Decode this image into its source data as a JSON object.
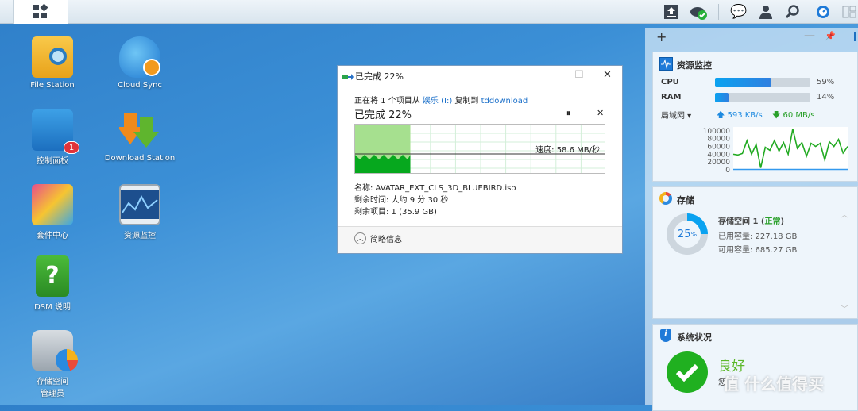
{
  "taskbar": {
    "icons": [
      "main-menu-icon",
      "upload-queue-icon",
      "cloud-sync-status-icon",
      "messages-icon",
      "user-icon",
      "search-icon",
      "widgets-icon",
      "panel-toggle-icon"
    ]
  },
  "desktop": {
    "icons": [
      {
        "label": "File Station",
        "icon": "file-station-icon"
      },
      {
        "label": "Cloud Sync",
        "icon": "cloud-sync-icon"
      },
      {
        "label": "控制面板",
        "icon": "control-panel-icon",
        "badge": "1"
      },
      {
        "label": "Download Station",
        "icon": "download-station-icon"
      },
      {
        "label": "套件中心",
        "icon": "package-center-icon"
      },
      {
        "label": "资源监控",
        "icon": "resource-monitor-icon"
      },
      {
        "label": "DSM 说明",
        "icon": "dsm-help-icon"
      },
      {
        "label": "存储空间\n管理员",
        "icon": "storage-manager-icon"
      }
    ]
  },
  "dialog": {
    "title": "已完成 22%",
    "copy_prefix": "正在将 1 个项目从",
    "source": "娱乐 (I:)",
    "copy_mid": "复制到",
    "destination": "tddownload",
    "progress_text": "已完成 22%",
    "progress": 22,
    "speed": "速度: 58.6 MB/秒",
    "name": "名称: AVATAR_EXT_CLS_3D_BLUEBIRD.iso",
    "time_left": "剩余时间: 大约 9 分 30 秒",
    "items_left": "剩余项目: 1 (35.9 GB)",
    "less_details": "简略信息",
    "colors": {
      "filled": "#06a81e",
      "light": "#a6e08f"
    }
  },
  "panel": {
    "resource": {
      "title": "资源监控",
      "cpu_label": "CPU",
      "cpu": 59,
      "cpu_text": "59%",
      "ram_label": "RAM",
      "ram": 14,
      "ram_text": "14%",
      "network": "局域网",
      "upload": "593 KB/s",
      "download": "60 MB/s",
      "chart_data": {
        "type": "line",
        "ylim": [
          0,
          110000
        ],
        "yticks": [
          "100000",
          "80000",
          "60000",
          "40000",
          "20000",
          "0"
        ],
        "series": [
          {
            "color": "#22aa22",
            "values": [
              40000,
              38000,
              42000,
              75000,
              40000,
              65000,
              5000,
              58000,
              50000,
              75000,
              48000,
              70000,
              40000,
              105000,
              55000,
              70000,
              35000,
              68000,
              60000,
              68000,
              25000,
              72000,
              60000,
              78000,
              43000,
              60000
            ]
          },
          {
            "color": "#3399ee",
            "values": [
              1000,
              1000,
              1000,
              1000,
              1000,
              1000,
              1000,
              1000,
              1000,
              1000,
              1000,
              1000,
              1000,
              1000,
              1000,
              1000,
              1000,
              1000,
              1000,
              1000,
              1000,
              1000,
              1000,
              1000,
              1000,
              1000
            ]
          }
        ]
      }
    },
    "storage": {
      "title": "存储",
      "percent": 25,
      "percent_text": "25",
      "volume": "存储空间 1 (",
      "status": "正常",
      "close": ")",
      "used": "已用容量: 227.18 GB",
      "free": "可用容量: 685.27 GB"
    },
    "health": {
      "title": "系统状况",
      "status": "良好",
      "desc": "您"
    }
  },
  "watermark": "值 什么值得买"
}
